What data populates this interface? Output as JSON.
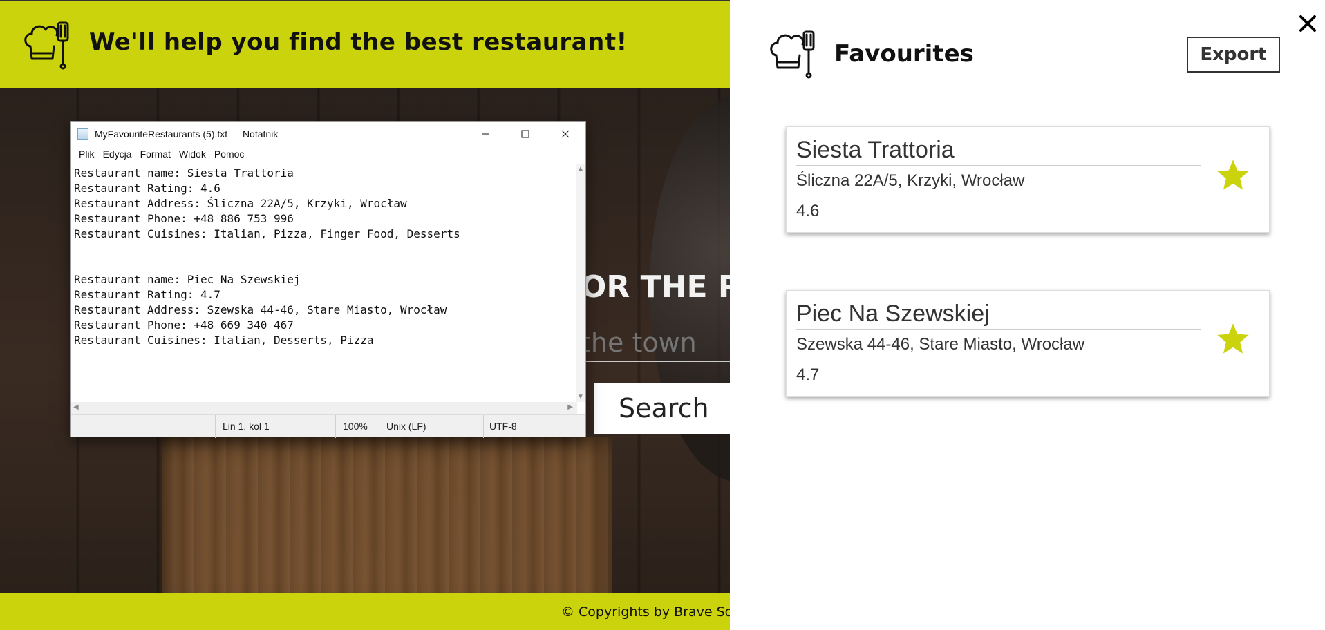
{
  "app": {
    "header_title": "We'll help you find the best restaurant!",
    "hero_heading": "OR THE RE",
    "search_placeholder": "the town",
    "search_button": "Search",
    "footer_text": "© Copyrights by Brave Squ"
  },
  "notepad": {
    "title": "MyFavouriteRestaurants (5).txt — Notatnik",
    "menu": [
      "Plik",
      "Edycja",
      "Format",
      "Widok",
      "Pomoc"
    ],
    "lines": [
      "Restaurant name: Siesta Trattoria",
      "Restaurant Rating: 4.6",
      "Restaurant Address: Śliczna 22A/5, Krzyki, Wrocław",
      "Restaurant Phone: +48 886 753 996",
      "Restaurant Cuisines: Italian, Pizza, Finger Food, Desserts",
      "",
      "",
      "Restaurant name: Piec Na Szewskiej",
      "Restaurant Rating: 4.7",
      "Restaurant Address: Szewska 44-46, Stare Miasto, Wrocław",
      "Restaurant Phone: +48 669 340 467",
      "Restaurant Cuisines: Italian, Desserts, Pizza"
    ],
    "status": {
      "position": "Lin 1, kol 1",
      "zoom": "100%",
      "line_ending": "Unix (LF)",
      "encoding": "UTF-8"
    }
  },
  "favourites": {
    "title": "Favourites",
    "export_label": "Export",
    "accent_color": "#cbd30d",
    "items": [
      {
        "name": "Siesta Trattoria",
        "address": "Śliczna 22A/5, Krzyki, Wrocław",
        "rating": "4.6"
      },
      {
        "name": "Piec Na Szewskiej",
        "address": "Szewska 44-46, Stare Miasto, Wrocław",
        "rating": "4.7"
      }
    ]
  }
}
